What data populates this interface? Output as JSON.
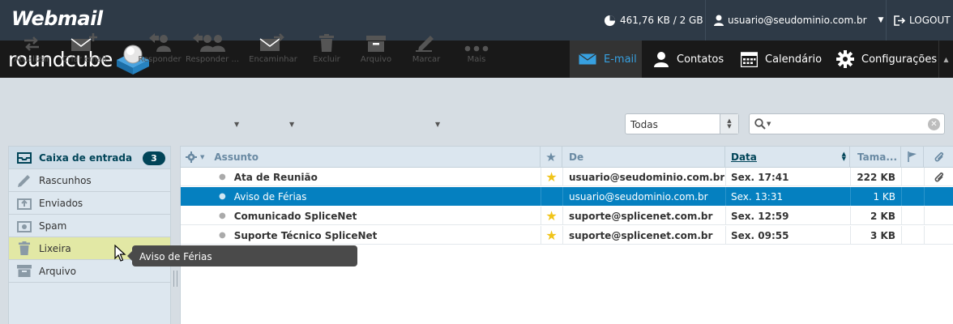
{
  "header": {
    "brand": "Webmail",
    "quota": "461,76 KB / 2 GB",
    "user": "usuario@seudominio.com.br",
    "logout": "LOGOUT"
  },
  "app": {
    "logo_text": "roundcube",
    "nav": [
      {
        "label": "E-mail",
        "active": true,
        "icon": "envelope-icon"
      },
      {
        "label": "Contatos",
        "active": false,
        "icon": "person-icon"
      },
      {
        "label": "Calendário",
        "active": false,
        "icon": "calendar-icon"
      },
      {
        "label": "Configurações",
        "active": false,
        "icon": "gear-icon"
      }
    ],
    "accent_color": "#37a0e0"
  },
  "toolbar": {
    "buttons": [
      {
        "label": "Atualizar",
        "icon": "refresh-icon"
      },
      {
        "label": "Criar email",
        "icon": "compose-icon"
      },
      {
        "label": "Responder",
        "icon": "reply-icon"
      },
      {
        "label": "Responder ...",
        "icon": "reply-all-icon"
      },
      {
        "label": "Encaminhar",
        "icon": "forward-icon"
      },
      {
        "label": "Excluir",
        "icon": "trash-icon"
      },
      {
        "label": "Arquivo",
        "icon": "archive-icon"
      },
      {
        "label": "Marcar",
        "icon": "mark-icon"
      },
      {
        "label": "Mais",
        "icon": "more-icon"
      }
    ],
    "filter_value": "Todas"
  },
  "folders": [
    {
      "label": "Caixa de entrada",
      "icon": "inbox-icon",
      "count": "3"
    },
    {
      "label": "Rascunhos",
      "icon": "pencil-icon"
    },
    {
      "label": "Enviados",
      "icon": "sent-icon"
    },
    {
      "label": "Spam",
      "icon": "spam-icon"
    },
    {
      "label": "Lixeira",
      "icon": "trash-icon"
    },
    {
      "label": "Arquivo",
      "icon": "archive-icon"
    }
  ],
  "list": {
    "columns": {
      "subject": "Assunto",
      "from": "De",
      "date": "Data",
      "size": "Tama..."
    },
    "rows": [
      {
        "subject": "Ata de Reunião",
        "from": "usuario@seudominio.com.br",
        "date": "Sex. 17:41",
        "size": "222 KB",
        "flagged": true,
        "attachment": true,
        "selected": false
      },
      {
        "subject": "Aviso de Férias",
        "from": "usuario@seudominio.com.br",
        "date": "Sex. 13:31",
        "size": "1 KB",
        "flagged": false,
        "attachment": false,
        "selected": true
      },
      {
        "subject": "Comunicado SpliceNet",
        "from": "suporte@splicenet.com.br",
        "date": "Sex. 12:59",
        "size": "2 KB",
        "flagged": true,
        "attachment": false,
        "selected": false
      },
      {
        "subject": "Suporte Técnico SpliceNet",
        "from": "suporte@splicenet.com.br",
        "date": "Sex. 09:55",
        "size": "3 KB",
        "flagged": true,
        "attachment": false,
        "selected": false
      }
    ],
    "selected_color": "#0580c0",
    "flag_color": "#f0c419"
  },
  "tooltip": "Aviso de Férias"
}
